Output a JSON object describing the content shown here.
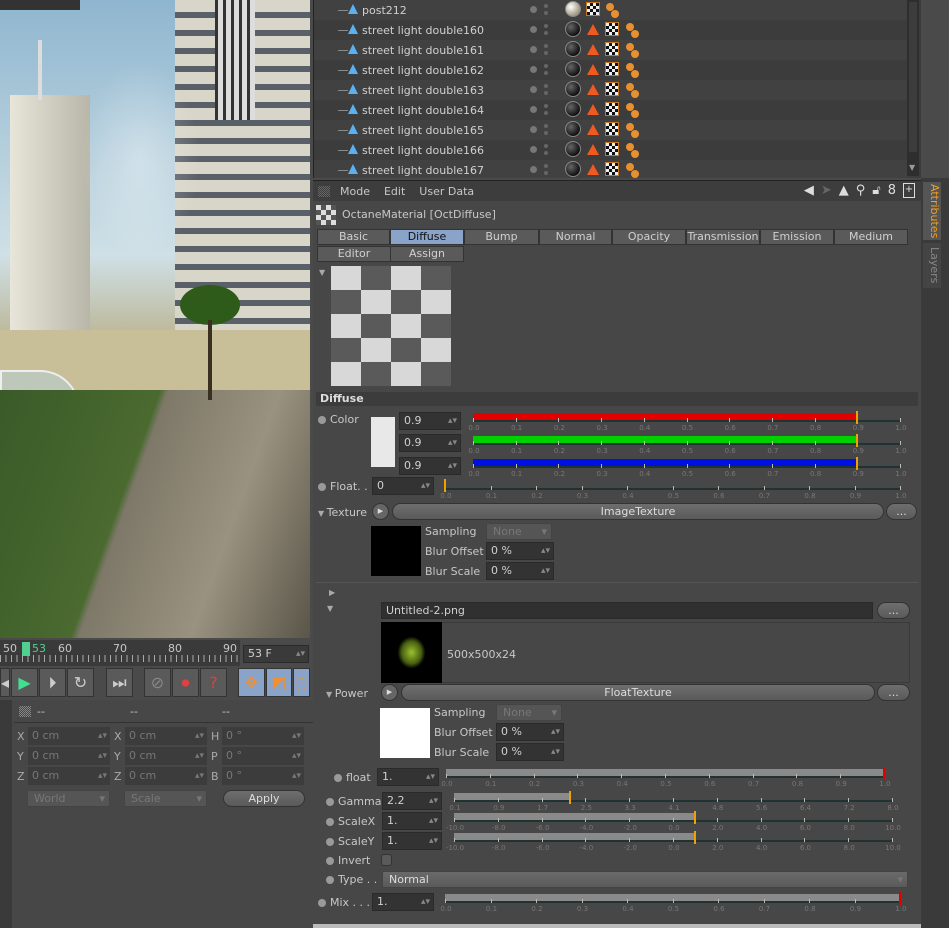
{
  "object_manager": {
    "items": [
      {
        "name": "post212",
        "material": "light"
      },
      {
        "name": "street light double160",
        "material": "dark"
      },
      {
        "name": "street light double161",
        "material": "dark"
      },
      {
        "name": "street light double162",
        "material": "dark"
      },
      {
        "name": "street light double163",
        "material": "dark"
      },
      {
        "name": "street light double164",
        "material": "dark"
      },
      {
        "name": "street light double165",
        "material": "dark"
      },
      {
        "name": "street light double166",
        "material": "dark"
      },
      {
        "name": "street light double167",
        "material": "dark"
      }
    ]
  },
  "attributes": {
    "menu": [
      "Mode",
      "Edit",
      "User Data"
    ],
    "toolbar_icons": [
      "back-arrow-icon",
      "forward-arrow-icon",
      "up-arrow-icon",
      "search-icon",
      "lock-icon",
      "link-icon",
      "new-panel-icon"
    ],
    "title": "OctaneMaterial [OctDiffuse]",
    "tabs_row1": [
      "Basic",
      "Diffuse",
      "Bump",
      "Normal",
      "Opacity",
      "Transmission",
      "Emission",
      "Medium"
    ],
    "tabs_row2": [
      "Editor",
      "Assign"
    ],
    "active_tab": "Diffuse",
    "section_title": "Diffuse",
    "color": {
      "label": "Color",
      "swatch": "#e8e8e8",
      "r": "0.9",
      "g": "0.9",
      "b": "0.9"
    },
    "float": {
      "label": "Float. .",
      "value": "0"
    },
    "texture": {
      "label": "Texture",
      "shader": "ImageTexture",
      "more": "...",
      "sampling_label": "Sampling",
      "sampling_value": "None",
      "blur_offset_label": "Blur Offset",
      "blur_offset_value": "0 %",
      "blur_scale_label": "Blur Scale",
      "blur_scale_value": "0 %"
    },
    "image": {
      "file": "Untitled-2.png",
      "more": "...",
      "info": "500x500x24"
    },
    "power": {
      "label": "Power",
      "shader": "FloatTexture",
      "more": "...",
      "sampling_label": "Sampling",
      "sampling_value": "None",
      "blur_offset_label": "Blur Offset",
      "blur_offset_value": "0 %",
      "blur_scale_label": "Blur Scale",
      "blur_scale_value": "0 %"
    },
    "float2": {
      "label": "float",
      "value": "1."
    },
    "gamma": {
      "label": "Gamma",
      "value": "2.2"
    },
    "scalex": {
      "label": "ScaleX",
      "value": "1."
    },
    "scaley": {
      "label": "ScaleY",
      "value": "1."
    },
    "invert": {
      "label": "Invert",
      "checked": false
    },
    "type": {
      "label": "Type . .",
      "value": "Normal"
    },
    "mix": {
      "label": "Mix . . .",
      "value": "1."
    }
  },
  "sliders": {
    "r": {
      "min": 0,
      "max": 1,
      "value": 0.9,
      "fill": "#e00000",
      "marker": "#f0a000",
      "ticks": [
        "0.0",
        "0.1",
        "0.2",
        "0.3",
        "0.4",
        "0.5",
        "0.6",
        "0.7",
        "0.8",
        "0.9",
        "1.0"
      ]
    },
    "g": {
      "min": 0,
      "max": 1,
      "value": 0.9,
      "fill": "#00d000",
      "marker": "#f0a000",
      "ticks": [
        "0.0",
        "0.1",
        "0.2",
        "0.3",
        "0.4",
        "0.5",
        "0.6",
        "0.7",
        "0.8",
        "0.9",
        "1.0"
      ]
    },
    "b": {
      "min": 0,
      "max": 1,
      "value": 0.9,
      "fill": "#0010e0",
      "marker": "#f0a000",
      "ticks": [
        "0.0",
        "0.1",
        "0.2",
        "0.3",
        "0.4",
        "0.5",
        "0.6",
        "0.7",
        "0.8",
        "0.9",
        "1.0"
      ]
    },
    "float": {
      "min": 0,
      "max": 1,
      "value": 0,
      "fill": "#8a8a8a",
      "marker": "#f0a000",
      "ticks": [
        "0.0",
        "0.1",
        "0.2",
        "0.3",
        "0.4",
        "0.5",
        "0.6",
        "0.7",
        "0.8",
        "0.9",
        "1.0"
      ]
    },
    "float2": {
      "min": 0,
      "max": 1,
      "value": 1,
      "fill": "#8a8a8a",
      "marker": "#e00000",
      "ticks": [
        "0.0",
        "0.1",
        "0.2",
        "0.3",
        "0.4",
        "0.5",
        "0.6",
        "0.7",
        "0.8",
        "0.9",
        "1.0"
      ]
    },
    "gamma": {
      "min": 0.1,
      "max": 8,
      "value": 2.2,
      "fill": "#8a8a8a",
      "marker": "#f0a000",
      "ticks": [
        "0.1",
        "0.9",
        "1.7",
        "2.5",
        "3.3",
        "4.1",
        "4.8",
        "5.6",
        "6.4",
        "7.2",
        "8.0"
      ]
    },
    "scalex": {
      "min": -10,
      "max": 10,
      "value": 1,
      "fill": "#8a8a8a",
      "marker": "#f0a000",
      "ticks": [
        "-10.0",
        "-8.0",
        "-6.0",
        "-4.0",
        "-2.0",
        "0.0",
        "2.0",
        "4.0",
        "6.0",
        "8.0",
        "10.0"
      ]
    },
    "scaley": {
      "min": -10,
      "max": 10,
      "value": 1,
      "fill": "#8a8a8a",
      "marker": "#f0a000",
      "ticks": [
        "-10.0",
        "-8.0",
        "-6.0",
        "-4.0",
        "-2.0",
        "0.0",
        "2.0",
        "4.0",
        "6.0",
        "8.0",
        "10.0"
      ]
    },
    "mix": {
      "min": 0,
      "max": 1,
      "value": 1,
      "fill": "#8a8a8a",
      "marker": "#e00000",
      "ticks": [
        "0.0",
        "0.1",
        "0.2",
        "0.3",
        "0.4",
        "0.5",
        "0.6",
        "0.7",
        "0.8",
        "0.9",
        "1.0"
      ]
    }
  },
  "side_tabs": [
    "Attributes",
    "Layers"
  ],
  "timeline": {
    "ticks": [
      "50",
      "60",
      "70",
      "80",
      "90"
    ],
    "current": "53",
    "frame_field": "53 F"
  },
  "coordinates": {
    "headers": [
      "--",
      "--",
      "--"
    ],
    "rows": [
      {
        "a": "X",
        "av": "0 cm",
        "b": "X",
        "bv": "0 cm",
        "c": "H",
        "cv": "0 °"
      },
      {
        "a": "Y",
        "av": "0 cm",
        "b": "Y",
        "bv": "0 cm",
        "c": "P",
        "cv": "0 °"
      },
      {
        "a": "Z",
        "av": "0 cm",
        "b": "Z",
        "bv": "0 cm",
        "c": "B",
        "cv": "0 °"
      }
    ],
    "space": "World",
    "mode": "Scale",
    "apply": "Apply"
  }
}
